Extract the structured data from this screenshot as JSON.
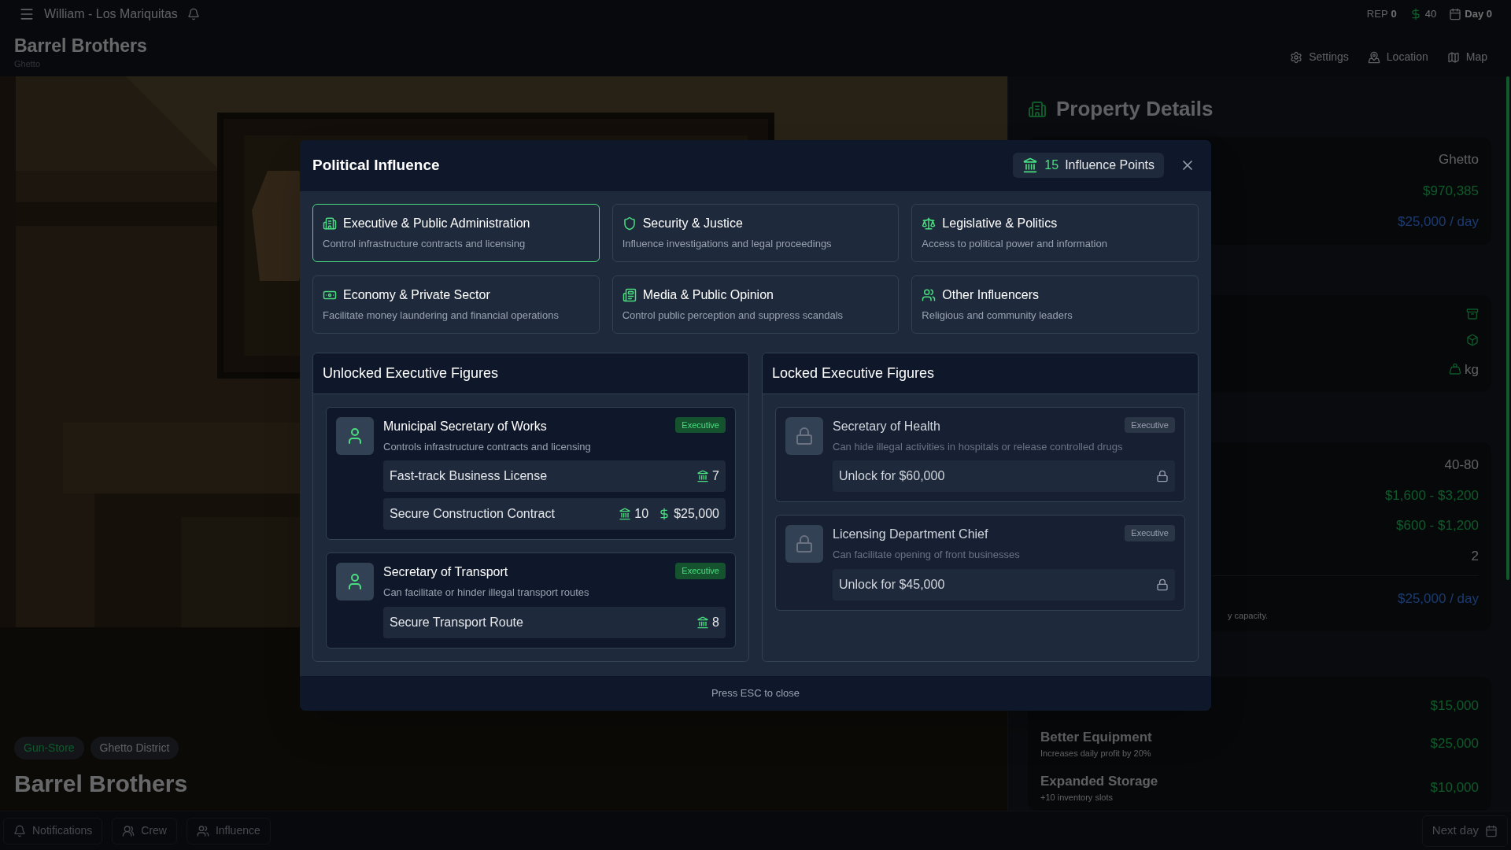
{
  "top_bar": {
    "title": "William - Los Mariquitas",
    "rep_label": "REP",
    "rep_value": "0",
    "money": "40",
    "day": "Day 0"
  },
  "header": {
    "title": "Barrel Brothers",
    "subtitle": "Ghetto",
    "actions": [
      {
        "label": "Settings",
        "kind": "settings"
      },
      {
        "label": "Location",
        "kind": "location"
      },
      {
        "label": "Map",
        "kind": "map"
      }
    ]
  },
  "hero": {
    "kind": "picture",
    "tags": [
      {
        "label": "Gun-Store",
        "kind": "type"
      },
      {
        "label": "Ghetto District",
        "kind": "district"
      }
    ],
    "title": "Barrel Brothers"
  },
  "property_details": {
    "title": "Property Details",
    "summary": [
      {
        "value": "Ghetto",
        "kind": "plain"
      },
      {
        "value": "$970,385",
        "kind": "money"
      },
      {
        "value": "$25,000 / day",
        "kind": "rate"
      }
    ],
    "storage_unit": "kg",
    "stats": [
      {
        "value": "40-80",
        "kind": "plain"
      },
      {
        "value": "$1,600 - $3,200",
        "kind": "money"
      },
      {
        "value": "$600 - $1,200",
        "kind": "money"
      },
      {
        "value": "2",
        "kind": "plain"
      }
    ],
    "total": "$25,000 / day",
    "note": "y capacity.",
    "upgrades": [
      {
        "price": "$15,000"
      },
      {
        "name": "Better Equipment",
        "description": "Increases daily profit by 20%",
        "price": "$25,000"
      },
      {
        "name": "Expanded Storage",
        "description": "+10 inventory slots",
        "price": "$10,000"
      }
    ]
  },
  "bottom_bar": {
    "buttons": [
      {
        "label": "Notifications",
        "kind": "notifications"
      },
      {
        "label": "Crew",
        "kind": "crew"
      },
      {
        "label": "Influence",
        "kind": "influence"
      }
    ],
    "next": "Next day"
  },
  "modal": {
    "title": "Political Influence",
    "points": "15",
    "points_label": "Influence Points",
    "categories": [
      {
        "label": "Executive & Public Administration",
        "description": "Control infrastructure contracts and licensing",
        "selected": true
      },
      {
        "label": "Security & Justice",
        "description": "Influence investigations and legal proceedings",
        "selected": false
      },
      {
        "label": "Legislative & Politics",
        "description": "Access to political power and information",
        "selected": false
      },
      {
        "label": "Economy & Private Sector",
        "description": "Facilitate money laundering and financial operations",
        "selected": false
      },
      {
        "label": "Media & Public Opinion",
        "description": "Control public perception and suppress scandals",
        "selected": false
      },
      {
        "label": "Other Influencers",
        "description": "Religious and community leaders",
        "selected": false
      }
    ],
    "unlocked": {
      "title": "Unlocked Executive Figures",
      "figures": [
        {
          "name": "Municipal Secretary of Works",
          "description": "Controls infrastructure contracts and licensing",
          "badge": "Executive",
          "actions": [
            {
              "label": "Fast-track Business License",
              "cost": "7"
            },
            {
              "label": "Secure Construction Contract",
              "cost": "10",
              "price": "$25,000"
            }
          ]
        },
        {
          "name": "Secretary of Transport",
          "description": "Can facilitate or hinder illegal transport routes",
          "badge": "Executive",
          "actions": [
            {
              "label": "Secure Transport Route",
              "cost": "8"
            }
          ]
        }
      ]
    },
    "locked": {
      "title": "Locked Executive Figures",
      "figures": [
        {
          "name": "Secretary of Health",
          "description": "Can hide illegal activities in hospitals or release controlled drugs",
          "badge": "Executive",
          "unlock": "Unlock for $60,000"
        },
        {
          "name": "Licensing Department Chief",
          "description": "Can facilitate opening of front businesses",
          "badge": "Executive",
          "unlock": "Unlock for $45,000"
        }
      ]
    },
    "footer": "Press ESC to close"
  }
}
